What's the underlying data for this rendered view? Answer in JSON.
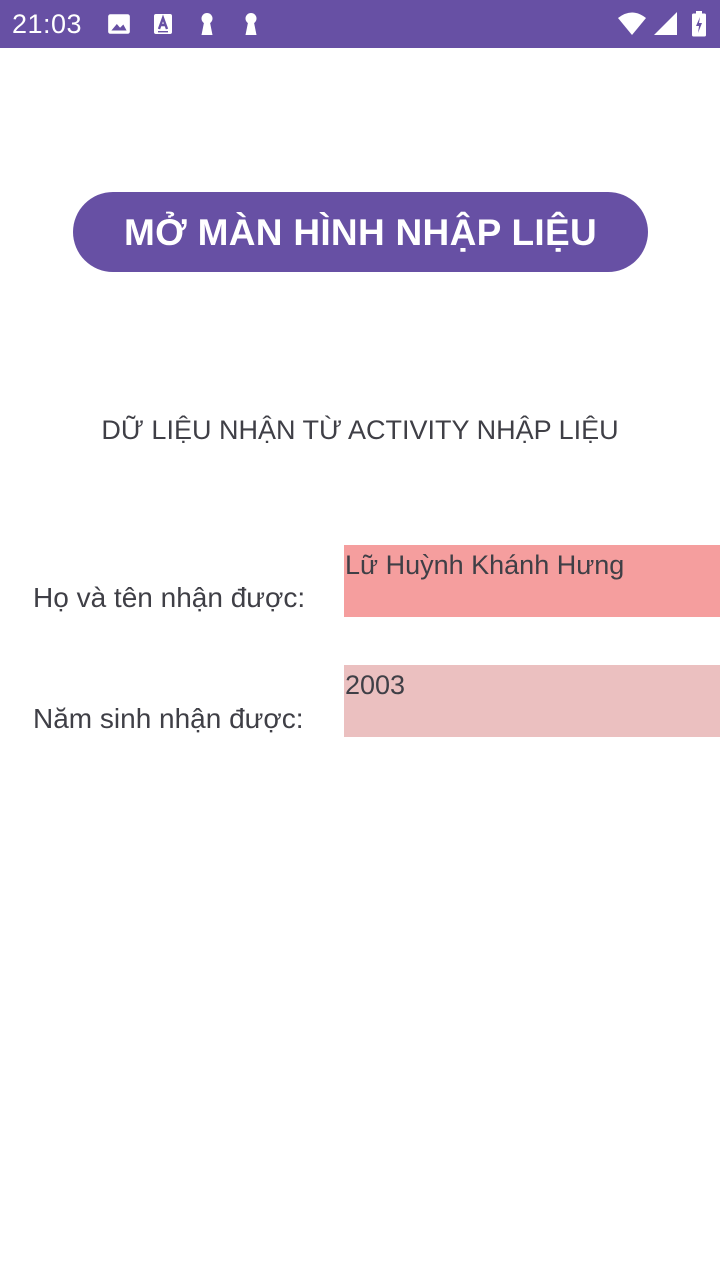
{
  "status_bar": {
    "time": "21:03",
    "background_color": "#6750a4",
    "left_icons": [
      "image-icon",
      "text-a-icon",
      "keyhole-icon",
      "keyhole-icon"
    ],
    "right_icons": [
      "wifi-icon",
      "cell-signal-icon",
      "battery-icon"
    ]
  },
  "main": {
    "open_button_label": "MỞ MÀN HÌNH NHẬP LIỆU",
    "section_title": "DỮ LIỆU NHẬN TỪ ACTIVITY NHẬP LIỆU",
    "fields": [
      {
        "label": "Họ và tên nhận được:",
        "value": "Lữ Huỳnh Khánh Hưng",
        "background_color": "#f59e9e"
      },
      {
        "label": "Năm sinh nhận được:",
        "value": "2003",
        "background_color": "#ebc0c0"
      }
    ]
  },
  "colors": {
    "accent": "#6750a4",
    "text": "#3f3f46"
  }
}
